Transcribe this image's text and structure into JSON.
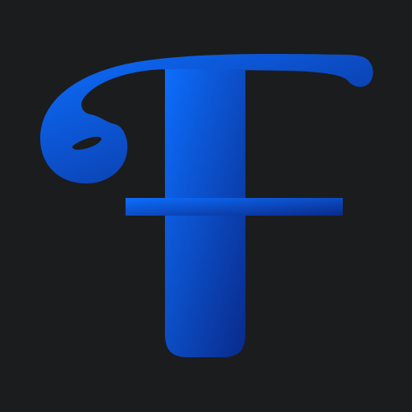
{
  "logo": {
    "letter": "F",
    "colors": {
      "background": "#1b1c1e",
      "gradient_start": "#0d6efd",
      "gradient_end": "#0a2a8a"
    }
  }
}
